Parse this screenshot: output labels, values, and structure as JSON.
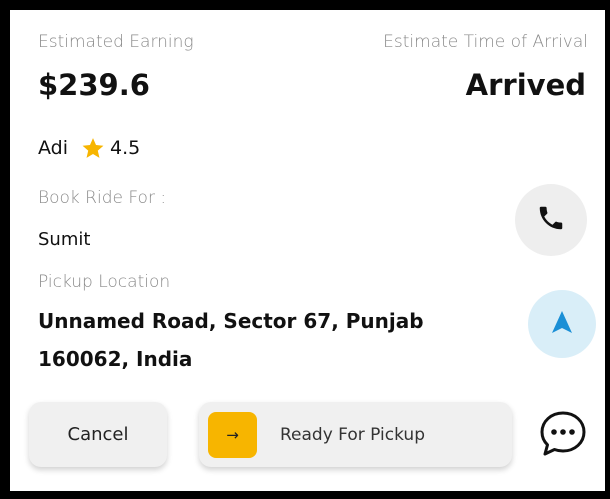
{
  "earning": {
    "label": "Estimated Earning",
    "amount": "$239.6"
  },
  "eta": {
    "label": "Estimate Time of Arrival",
    "status": "Arrived"
  },
  "driver": {
    "name": "Adi",
    "rating": "4.5",
    "star_color": "#f7b500"
  },
  "booking": {
    "label": "Book Ride For :",
    "name": "Sumit"
  },
  "pickup": {
    "label": "Pickup Location",
    "address": "Unnamed Road, Sector 67, Punjab 160062, India"
  },
  "actions": {
    "cancel_label": "Cancel",
    "ready_label": "Ready For Pickup",
    "ready_arrow": "→",
    "call_icon": "phone-icon",
    "navigate_icon": "navigation-arrow-icon",
    "chat_icon": "chat-bubble-icon"
  },
  "colors": {
    "accent": "#f7b500",
    "navigate": "#1a8fd6",
    "navigate_bg": "#d9eef8"
  }
}
